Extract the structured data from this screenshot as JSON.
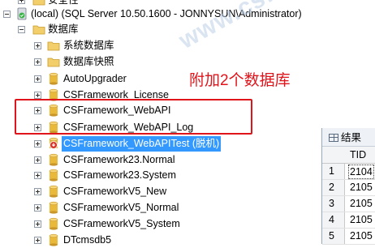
{
  "tree": {
    "top_partial": {
      "label": "安全性"
    },
    "server": {
      "label": "(local) (SQL Server 10.50.1600 - JONNYSUN\\Administrator)"
    },
    "databases_folder": {
      "label": "数据库"
    },
    "items": [
      {
        "label": "系统数据库",
        "icon": "folder-icon"
      },
      {
        "label": "数据库快照",
        "icon": "folder-icon"
      },
      {
        "label": "AutoUpgrader",
        "icon": "database-icon"
      },
      {
        "label": "CSFramework_License",
        "icon": "database-icon"
      },
      {
        "label": "CSFramework_WebAPI",
        "icon": "database-icon"
      },
      {
        "label": "CSFramework_WebAPI_Log",
        "icon": "database-icon"
      },
      {
        "label": "CSFramework_WebAPITest (脱机)",
        "icon": "database-offline-icon",
        "selected": true
      },
      {
        "label": "CSFramework23.Normal",
        "icon": "database-icon"
      },
      {
        "label": "CSFramework23.System",
        "icon": "database-icon"
      },
      {
        "label": "CSFrameworkV5_New",
        "icon": "database-icon"
      },
      {
        "label": "CSFrameworkV5_Normal",
        "icon": "database-icon"
      },
      {
        "label": "CSFrameworkV5_System",
        "icon": "database-icon"
      },
      {
        "label": "DTcmsdb5",
        "icon": "database-icon"
      }
    ]
  },
  "annotation": {
    "text": "附加2个数据库",
    "color": "#e0141b"
  },
  "watermark": {
    "text": "www.csframework.com"
  },
  "results": {
    "tab_label": "结果",
    "column_header": "TID",
    "rows": [
      {
        "num": "1",
        "value": "2104"
      },
      {
        "num": "2",
        "value": "2105"
      },
      {
        "num": "3",
        "value": "2105"
      },
      {
        "num": "4",
        "value": "2105"
      },
      {
        "num": "5",
        "value": "2105"
      }
    ]
  },
  "colors": {
    "selection": "#3399ff",
    "annotation": "#e0141b",
    "db_icon": "#e8b93a",
    "folder": "#f2cf6b"
  }
}
